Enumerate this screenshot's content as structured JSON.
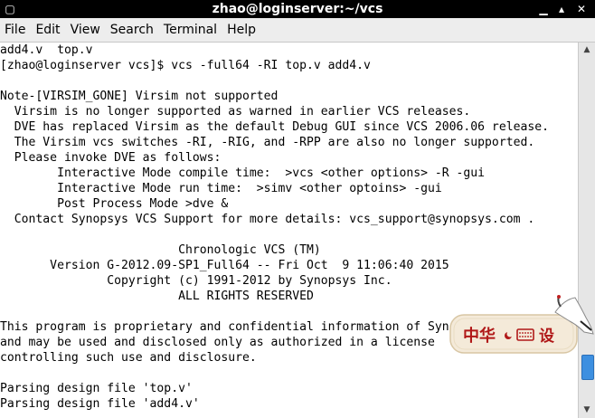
{
  "window": {
    "title": "zhao@loginserver:~/vcs"
  },
  "titlebar_icons": [
    "window-menu-icon",
    "minimize-icon",
    "maximize-icon",
    "close-icon"
  ],
  "menu": [
    "File",
    "Edit",
    "View",
    "Search",
    "Terminal",
    "Help"
  ],
  "terminal": {
    "lines": [
      "add4.v  top.v",
      "[zhao@loginserver vcs]$ vcs -full64 -RI top.v add4.v",
      "",
      "Note-[VIRSIM_GONE] Virsim not supported",
      "  Virsim is no longer supported as warned in earlier VCS releases.",
      "  DVE has replaced Virsim as the default Debug GUI since VCS 2006.06 release.",
      "  The Virsim vcs switches -RI, -RIG, and -RPP are also no longer supported.",
      "  Please invoke DVE as follows:",
      "        Interactive Mode compile time:  >vcs <other options> -R -gui",
      "        Interactive Mode run time:  >simv <other optoins> -gui",
      "        Post Process Mode >dve &",
      "  Contact Synopsys VCS Support for more details: vcs_support@synopsys.com .",
      "",
      "                         Chronologic VCS (TM)",
      "       Version G-2012.09-SP1_Full64 -- Fri Oct  9 11:06:40 2015",
      "               Copyright (c) 1991-2012 by Synopsys Inc.",
      "                         ALL RIGHTS RESERVED",
      "",
      "This program is proprietary and confidential information of Syn",
      "and may be used and disclosed only as authorized in a license",
      "controlling such use and disclosure.",
      "",
      "Parsing design file 'top.v'",
      "Parsing design file 'add4.v'"
    ]
  },
  "ime_toolbar": {
    "label": "中华",
    "icons": [
      "moon-icon",
      "keyboard-icon",
      "settings-icon"
    ],
    "settings_label": "设"
  },
  "colors": {
    "titlebar": "#000000",
    "menubar": "#ededed",
    "scroll_thumb": "#3d8fe0",
    "terminal_bg": "#ffffff"
  }
}
